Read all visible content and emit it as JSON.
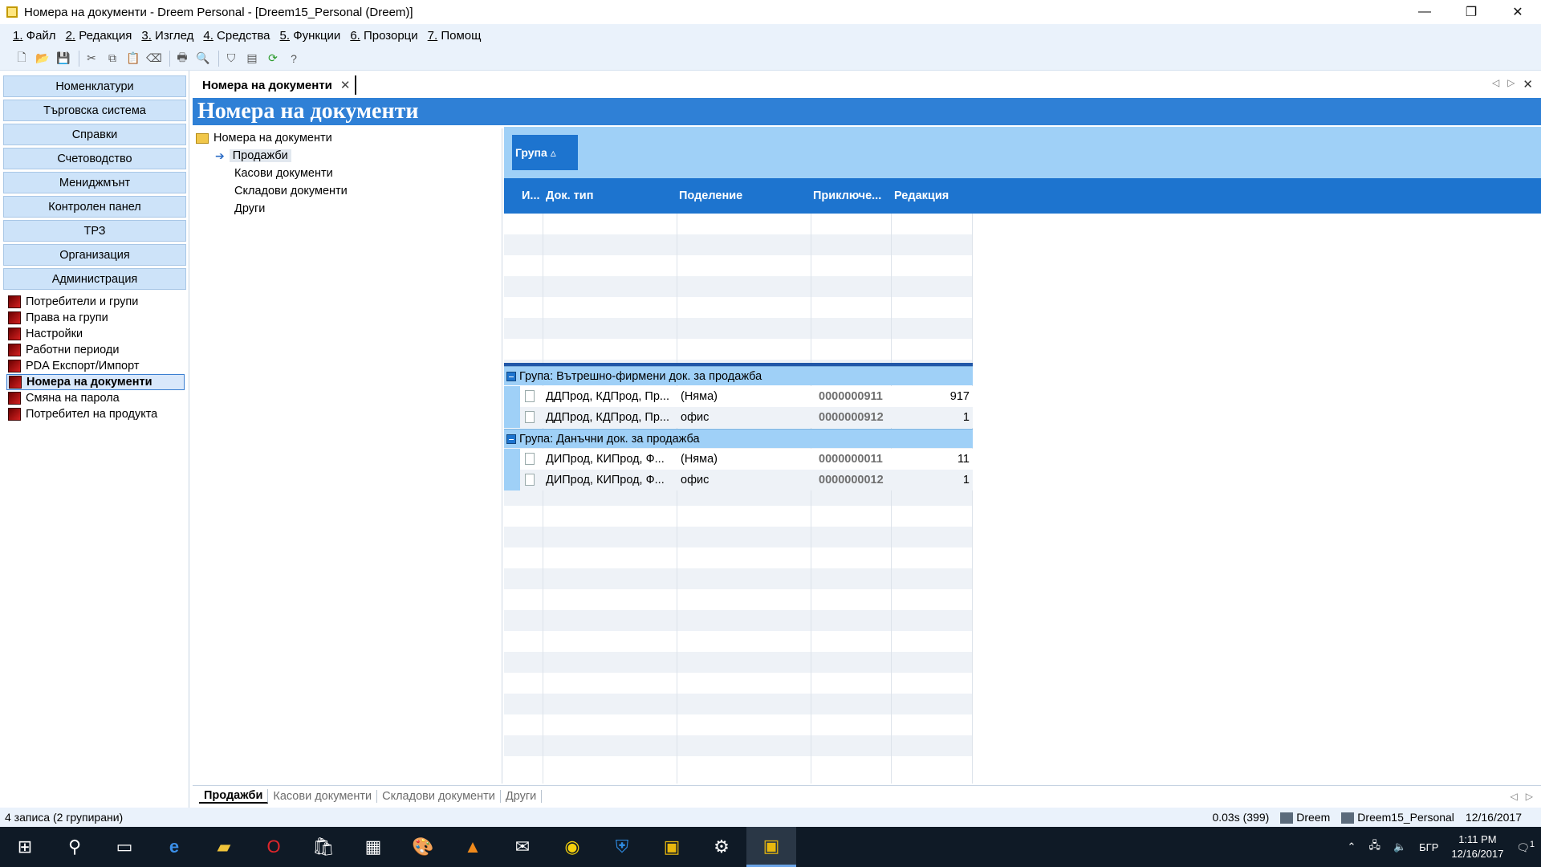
{
  "window": {
    "title": "Номера на документи - Dreem Personal - [Dreem15_Personal (Dreem)]",
    "controls": {
      "minimize": "—",
      "restore": "❐",
      "close": "✕"
    }
  },
  "menu": [
    {
      "num": "1.",
      "label": " Файл"
    },
    {
      "num": "2.",
      "label": " Редакция"
    },
    {
      "num": "3.",
      "label": " Изглед"
    },
    {
      "num": "4.",
      "label": " Средства"
    },
    {
      "num": "5.",
      "label": " Функции"
    },
    {
      "num": "6.",
      "label": " Прозорци"
    },
    {
      "num": "7.",
      "label": " Помощ"
    }
  ],
  "toolbar_icons": [
    "new-icon",
    "open-icon",
    "save-icon",
    "cut-icon",
    "copy-icon",
    "paste-icon",
    "erase-icon",
    "print-icon",
    "print-preview-icon",
    "filter-icon",
    "layout-icon",
    "refresh-icon",
    "help-icon"
  ],
  "nav": {
    "buttons": [
      "Номенклатури",
      "Търговска система",
      "Справки",
      "Счетоводство",
      "Мениджмънт",
      "Контролен панел",
      "ТРЗ",
      "Организация",
      "Администрация"
    ],
    "subitems": [
      "Потребители и групи",
      "Права на групи",
      "Настройки",
      "Работни периоди",
      "PDA Експорт/Импорт",
      "Номера на документи",
      "Смяна на парола",
      "Потребител на продукта"
    ],
    "selected_subitem": "Номера на документи"
  },
  "doc_tab": {
    "label": "Номера на документи",
    "close": "✕"
  },
  "banner": {
    "title": "Номера на документи"
  },
  "tree": {
    "root": "Номера на документи",
    "children": [
      "Продажби",
      "Касови документи",
      "Складови документи",
      "Други"
    ],
    "selected": "Продажби"
  },
  "grid": {
    "group_chip": "Група ▵",
    "columns": [
      "И...",
      "Док. тип",
      "Поделение",
      "Приключе...",
      "Редакция"
    ],
    "groups": [
      {
        "label": "Група: Вътрешно-фирмени док. за продажба",
        "rows": [
          {
            "doc_type": "ДДПрод, КДПрод, Пр...",
            "division": "(Няма)",
            "closed": "0000000911",
            "edition": "917"
          },
          {
            "doc_type": "ДДПрод, КДПрод, Пр...",
            "division": "офис",
            "closed": "0000000912",
            "edition": "1"
          }
        ]
      },
      {
        "label": "Група: Данъчни док. за продажба",
        "rows": [
          {
            "doc_type": "ДИПрод, КИПрод, Ф...",
            "division": "(Няма)",
            "closed": "0000000011",
            "edition": "11"
          },
          {
            "doc_type": "ДИПрод, КИПрод, Ф...",
            "division": "офис",
            "closed": "0000000012",
            "edition": "1"
          }
        ]
      }
    ]
  },
  "bottom_tabs": [
    "Продажби",
    "Касови документи",
    "Складови документи",
    "Други"
  ],
  "status": {
    "left": "4 записа (2 групирани)",
    "timing": "0.03s (399)",
    "user": "Dreem",
    "database": "Dreem15_Personal",
    "date": "12/16/2017"
  },
  "taskbar": {
    "apps": [
      "windows-start-icon",
      "search-icon",
      "task-view-icon",
      "edge-icon",
      "file-explorer-icon",
      "opera-icon",
      "store-icon",
      "calculator-icon",
      "paint-icon",
      "vlc-icon",
      "mail-icon",
      "app-c-icon",
      "shield-icon",
      "dreem-icon",
      "settings-icon",
      "dreem-active-icon"
    ],
    "language": "БГР",
    "time": "1:11 PM",
    "date": "12/16/2017",
    "notifications": "1"
  },
  "colors": {
    "accent": "#1d74cf",
    "banner": "#2f80d6",
    "group": "#9fd0f7",
    "nav": "#cde3f9"
  }
}
